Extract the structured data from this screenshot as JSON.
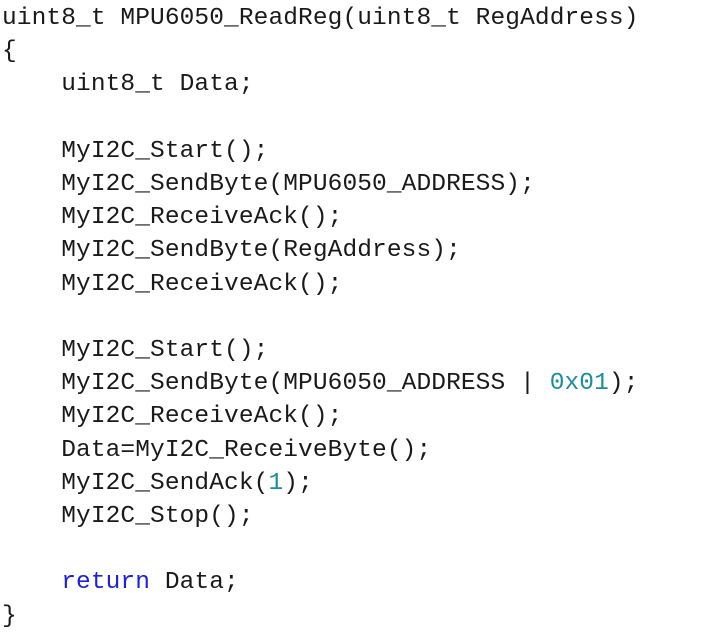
{
  "editor": {
    "colors": {
      "background": "#ffffff",
      "text": "#1a1a1a",
      "keyword": "#1f1fe0",
      "number": "#1a8f9a"
    },
    "lines": [
      {
        "tokens": [
          {
            "t": "plain",
            "text": "uint8_t MPU6050_ReadReg(uint8_t RegAddress)"
          }
        ]
      },
      {
        "tokens": [
          {
            "t": "plain",
            "text": "{"
          }
        ]
      },
      {
        "tokens": [
          {
            "t": "plain",
            "text": "    uint8_t Data;"
          }
        ]
      },
      {
        "tokens": [
          {
            "t": "plain",
            "text": ""
          }
        ]
      },
      {
        "tokens": [
          {
            "t": "plain",
            "text": "    MyI2C_Start();"
          }
        ]
      },
      {
        "tokens": [
          {
            "t": "plain",
            "text": "    MyI2C_SendByte(MPU6050_ADDRESS);"
          }
        ]
      },
      {
        "tokens": [
          {
            "t": "plain",
            "text": "    MyI2C_ReceiveAck();"
          }
        ]
      },
      {
        "tokens": [
          {
            "t": "plain",
            "text": "    MyI2C_SendByte(RegAddress);"
          }
        ]
      },
      {
        "tokens": [
          {
            "t": "plain",
            "text": "    MyI2C_ReceiveAck();"
          }
        ]
      },
      {
        "tokens": [
          {
            "t": "plain",
            "text": ""
          }
        ]
      },
      {
        "tokens": [
          {
            "t": "plain",
            "text": "    MyI2C_Start();"
          }
        ]
      },
      {
        "tokens": [
          {
            "t": "plain",
            "text": "    MyI2C_SendByte(MPU6050_ADDRESS | "
          },
          {
            "t": "num",
            "text": "0x01"
          },
          {
            "t": "plain",
            "text": ");"
          }
        ]
      },
      {
        "tokens": [
          {
            "t": "plain",
            "text": "    MyI2C_ReceiveAck();"
          }
        ]
      },
      {
        "tokens": [
          {
            "t": "plain",
            "text": "    Data=MyI2C_ReceiveByte();"
          }
        ]
      },
      {
        "tokens": [
          {
            "t": "plain",
            "text": "    MyI2C_SendAck("
          },
          {
            "t": "num",
            "text": "1"
          },
          {
            "t": "plain",
            "text": ");"
          }
        ]
      },
      {
        "tokens": [
          {
            "t": "plain",
            "text": "    MyI2C_Stop();"
          }
        ]
      },
      {
        "tokens": [
          {
            "t": "plain",
            "text": ""
          }
        ]
      },
      {
        "tokens": [
          {
            "t": "plain",
            "text": "    "
          },
          {
            "t": "kw",
            "text": "return"
          },
          {
            "t": "plain",
            "text": " Data;"
          }
        ]
      },
      {
        "tokens": [
          {
            "t": "plain",
            "text": "}"
          }
        ]
      }
    ]
  }
}
